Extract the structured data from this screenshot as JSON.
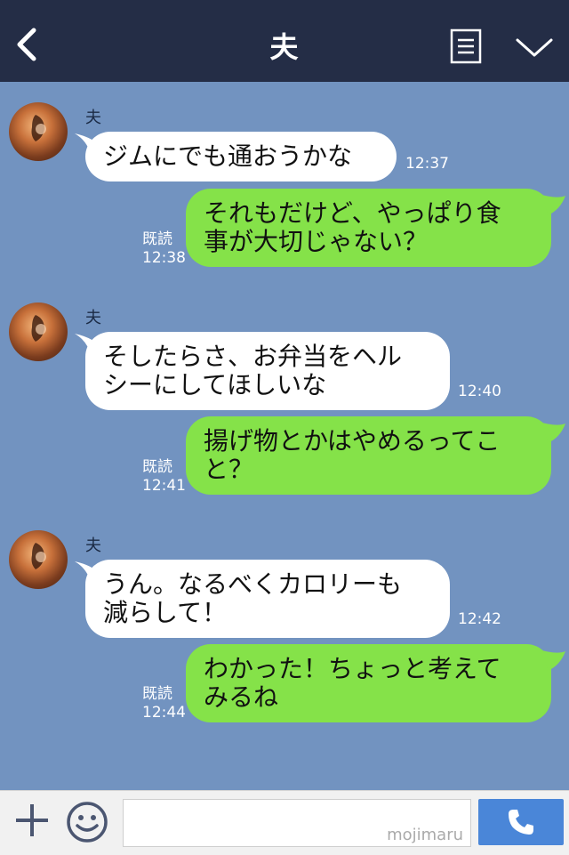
{
  "header": {
    "title": "夫"
  },
  "messages": [
    {
      "from": "夫",
      "text": "ジムにでも通おうかな",
      "time": "12:37"
    },
    {
      "text": "それもだけど、やっぱり食\n事が大切じゃない？",
      "status": "既読",
      "time": "12:38"
    },
    {
      "from": "夫",
      "text": "そしたらさ、お弁当をヘル\nシーにしてほしいな",
      "time": "12:40"
    },
    {
      "text": "揚げ物とかはやめるってこ\nと？",
      "status": "既読",
      "time": "12:41"
    },
    {
      "from": "夫",
      "text": "うん。なるべくカロリーも\n減らして！",
      "time": "12:42"
    },
    {
      "text": "わかった！ちょっと考えて\nみるね",
      "status": "既読",
      "time": "12:44"
    }
  ],
  "footer": {
    "watermark": "mojimaru"
  },
  "colors": {
    "header": "#242d46",
    "background": "#7293c0",
    "sent_bubble": "#85e249",
    "received_bubble": "#ffffff",
    "call_button": "#4a86d8"
  }
}
